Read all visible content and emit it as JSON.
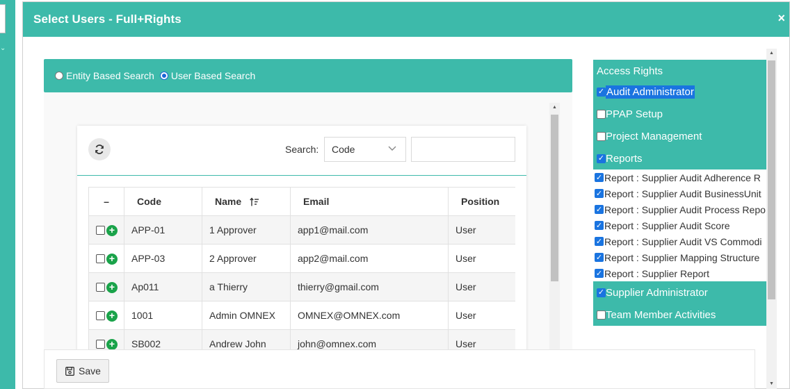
{
  "modal": {
    "title": "Select Users - Full+Rights",
    "close_glyph": "×"
  },
  "search_type": {
    "options": [
      {
        "label": "Entity Based Search",
        "selected": false
      },
      {
        "label": "User Based Search",
        "selected": true
      }
    ]
  },
  "grid": {
    "search_label": "Search:",
    "search_field_selected": "Code",
    "search_value": "",
    "columns": [
      "–",
      "Code",
      "Name",
      "Email",
      "Position"
    ],
    "sort_icon": "sort-ascending-icon",
    "rows": [
      {
        "code": "APP-01",
        "name": "1 Approver",
        "email": "app1@mail.com",
        "position": "User"
      },
      {
        "code": "APP-03",
        "name": "2 Approver",
        "email": "app2@mail.com",
        "position": "User"
      },
      {
        "code": "Ap011",
        "name": "a Thierry",
        "email": "thierry@gmail.com",
        "position": "User"
      },
      {
        "code": "1001",
        "name": "Admin OMNEX",
        "email": "OMNEX@OMNEX.com",
        "position": "User"
      },
      {
        "code": "SB002",
        "name": "Andrew John",
        "email": "john@omnex.com",
        "position": "User"
      }
    ]
  },
  "footer": {
    "save_label": "Save",
    "save_icon": "floppy-disk-icon"
  },
  "access_rights": {
    "title": "Access Rights",
    "groups": [
      {
        "label": "Audit Administrator",
        "checked": true,
        "highlighted": true,
        "children": []
      },
      {
        "label": "PPAP Setup",
        "checked": false,
        "highlighted": false,
        "children": []
      },
      {
        "label": "Project Management",
        "checked": false,
        "highlighted": false,
        "children": []
      },
      {
        "label": "Reports",
        "checked": true,
        "highlighted": false,
        "children": [
          {
            "label": "Report : Supplier Audit Adherence R",
            "checked": true
          },
          {
            "label": "Report : Supplier Audit BusinessUnit",
            "checked": true
          },
          {
            "label": "Report : Supplier Audit Process Repo",
            "checked": true
          },
          {
            "label": "Report : Supplier Audit Score",
            "checked": true
          },
          {
            "label": "Report : Supplier Audit VS Commodi",
            "checked": true
          },
          {
            "label": "Report : Supplier Mapping Structure",
            "checked": true
          },
          {
            "label": "Report : Supplier Report",
            "checked": true
          }
        ]
      },
      {
        "label": "Supplier Administrator",
        "checked": true,
        "highlighted": false,
        "children": []
      },
      {
        "label": "Team Member Activities",
        "checked": false,
        "highlighted": false,
        "children": []
      }
    ]
  },
  "colors": {
    "teal": "#3dbaaa",
    "check_blue": "#1a74e0",
    "add_green": "#1aa34a"
  }
}
